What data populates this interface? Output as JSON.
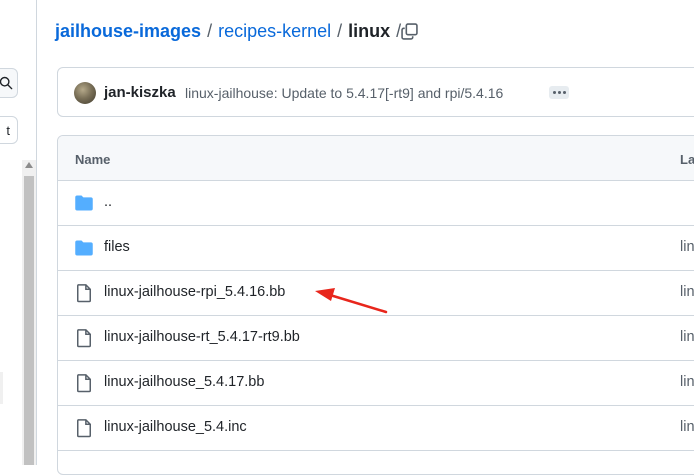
{
  "breadcrumb": {
    "repo": "jailhouse-images",
    "sep1": "/",
    "folder": "recipes-kernel",
    "sep2": "/",
    "current": "linux",
    "sep3": "/"
  },
  "left_panel": {
    "chip_text": "t"
  },
  "commit": {
    "author": "jan-kiszka",
    "message": "linux-jailhouse: Update to 5.4.17[-rt9] and rpi/5.4.16"
  },
  "table": {
    "header_name": "Name",
    "header_last_commit": "La",
    "rows": [
      {
        "name": "..",
        "type": "folder",
        "commit": ""
      },
      {
        "name": "files",
        "type": "folder",
        "commit": "lin"
      },
      {
        "name": "linux-jailhouse-rpi_5.4.16.bb",
        "type": "file",
        "commit": "lin"
      },
      {
        "name": "linux-jailhouse-rt_5.4.17-rt9.bb",
        "type": "file",
        "commit": "lin"
      },
      {
        "name": "linux-jailhouse_5.4.17.bb",
        "type": "file",
        "commit": "lin"
      },
      {
        "name": "linux-jailhouse_5.4.inc",
        "type": "file",
        "commit": "lin"
      }
    ]
  },
  "icons": {
    "copy": "copy-icon",
    "search": "search-icon",
    "folder": "folder-icon",
    "file": "file-icon",
    "kebab": "ellipsis-icon"
  },
  "colors": {
    "link": "#0969da",
    "folder": "#54aeff",
    "annotation": "#e8261c",
    "border": "#d0d7de"
  }
}
